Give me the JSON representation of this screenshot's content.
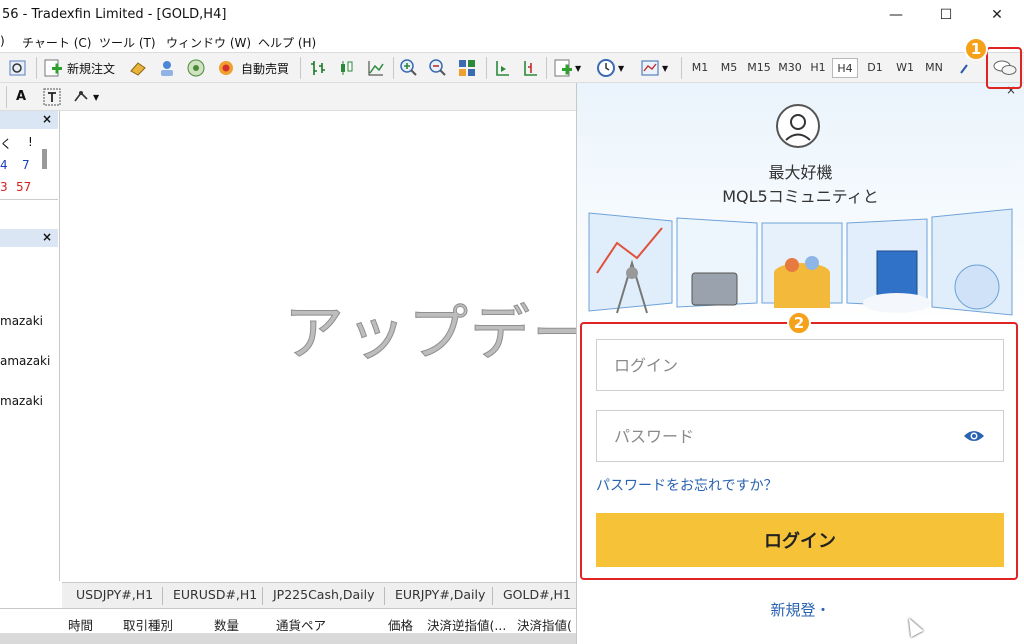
{
  "window": {
    "title": "56 - Tradexfin Limited - [GOLD,H4]",
    "minimize": "—",
    "maximize": "☐",
    "close": "✕"
  },
  "menu": {
    "items": [
      "チャート (C)",
      "ツール (T)",
      "ウィンドウ (W)",
      "ヘルプ (H)"
    ],
    "leading": ")"
  },
  "toolbar": {
    "new_order": "新規注文",
    "auto_trade": "自動売買",
    "timeframes": [
      "M1",
      "M5",
      "M15",
      "M30",
      "H1",
      "H4",
      "D1",
      "W1",
      "MN"
    ],
    "active_timeframe": "H4"
  },
  "toolbar2": {
    "text_tool": "A"
  },
  "left_pane": {
    "top_header_cols": [
      "く",
      "!"
    ],
    "top_rows": [
      {
        "a": "4",
        "b": "7",
        "color": "#1a3fc4"
      },
      {
        "a": "3",
        "b": "57",
        "color": "#d62020"
      }
    ],
    "list_items": [
      "mazaki",
      "amazaki",
      "mazaki"
    ],
    "close": "×"
  },
  "chart": {
    "overlay_text": "アップデー"
  },
  "tabs": [
    "USDJPY#,H1",
    "EURUSD#,H1",
    "JP225Cash,Daily",
    "EURJPY#,Daily",
    "GOLD#,H1"
  ],
  "trade_columns": [
    "時間",
    "取引種別",
    "数量",
    "通貨ペア",
    "価格",
    "決済逆指値(...",
    "決済指値("
  ],
  "panel": {
    "tagline_line1": "最大好機",
    "tagline_line2": "MQL5コミュニティと",
    "login_placeholder": "ログイン",
    "password_placeholder": "パスワード",
    "forgot": "パスワードをお忘れですか？",
    "login_button": "ログイン",
    "register": "新規登・",
    "close": "×"
  },
  "annotations": {
    "badge1": "1",
    "badge2": "2"
  },
  "colors": {
    "highlight": "#e02424",
    "badge": "#f5a21a",
    "login_button": "#f6c237",
    "link": "#2a63b2"
  }
}
